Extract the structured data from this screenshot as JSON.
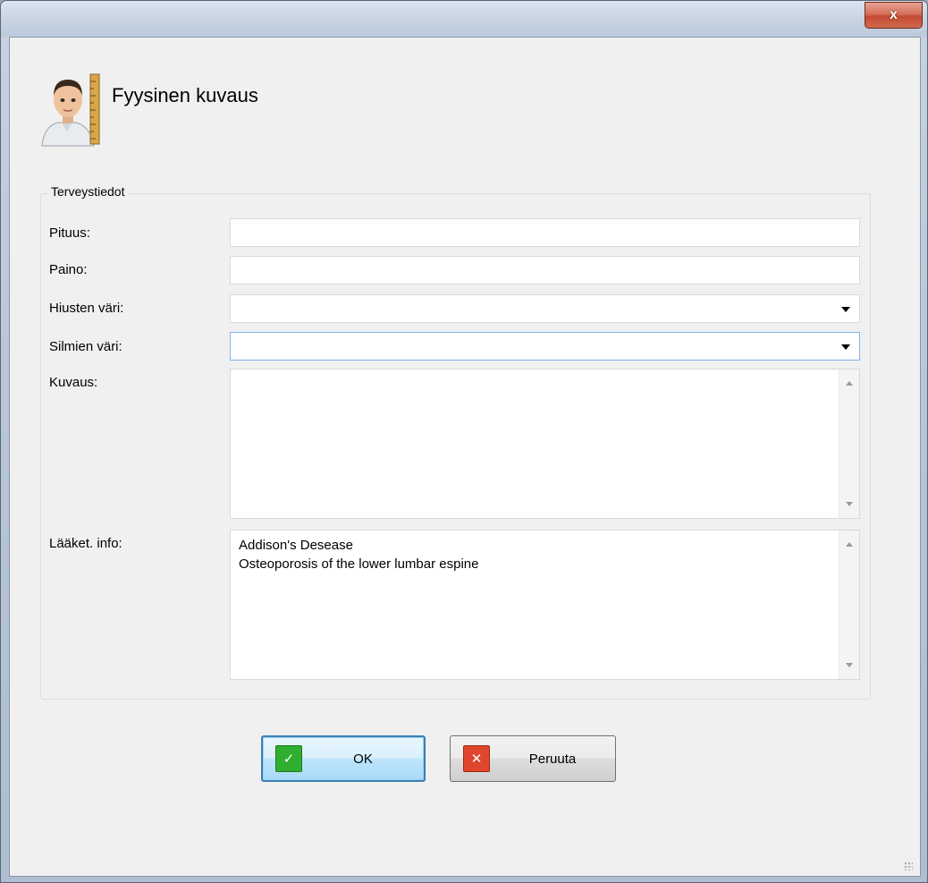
{
  "window": {
    "close_label": "x"
  },
  "header": {
    "title": "Fyysinen kuvaus",
    "icon": "person-with-ruler-icon"
  },
  "group": {
    "legend": "Terveystiedot"
  },
  "form": {
    "pituus_label": "Pituus:",
    "pituus_value": "",
    "paino_label": "Paino:",
    "paino_value": "",
    "hiusten_label": "Hiusten väri:",
    "hiusten_value": "",
    "silmien_label": "Silmien väri:",
    "silmien_value": "",
    "kuvaus_label": "Kuvaus:",
    "kuvaus_value": "",
    "laaket_label": "Lääket. info:",
    "laaket_value": "Addison's Desease\nOsteoporosis of the lower lumbar espine"
  },
  "buttons": {
    "ok_label": "OK",
    "cancel_label": "Peruuta"
  },
  "colors": {
    "ok_icon": "#2fae2f",
    "cancel_icon": "#e0452d"
  }
}
